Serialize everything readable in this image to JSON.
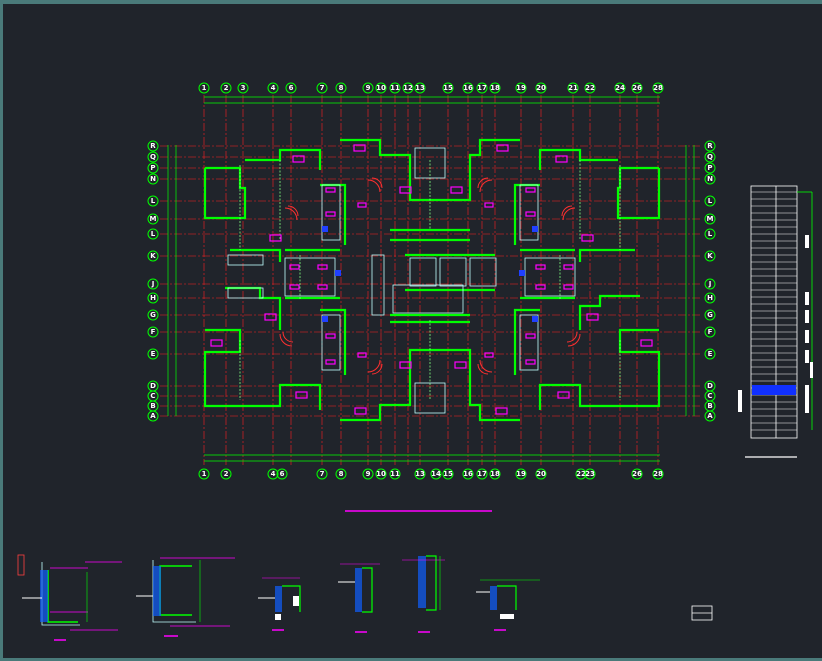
{
  "drawing": {
    "grid_axes_top": [
      "1",
      "2",
      "3",
      "4",
      "6",
      "7",
      "8",
      "9",
      "10",
      "11",
      "12",
      "13",
      "15",
      "16",
      "17",
      "18",
      "19",
      "20",
      "21",
      "22",
      "24",
      "26",
      "28"
    ],
    "grid_axes_bottom": [
      "1",
      "2",
      "4",
      "6",
      "7",
      "8",
      "9",
      "10",
      "11",
      "13",
      "14",
      "15",
      "16",
      "17",
      "18",
      "19",
      "20",
      "22",
      "23",
      "26",
      "28"
    ],
    "grid_axes_left": [
      "R",
      "Q",
      "P",
      "N",
      "L",
      "M",
      "L",
      "K",
      "J",
      "H",
      "G",
      "F",
      "E",
      "D",
      "C",
      "B",
      "A"
    ],
    "grid_axes_right": [
      "R",
      "Q",
      "P",
      "N",
      "L",
      "M",
      "L",
      "K",
      "J",
      "H",
      "G",
      "F",
      "E",
      "D",
      "C",
      "B",
      "A"
    ],
    "colors": {
      "background": "#20242b",
      "wall": "#00ff00",
      "grid_line": "#ff2020",
      "dimension": "#00ff00",
      "window": "#ff00ff",
      "door_swing": "#ff3030",
      "furniture": "#c0ffff",
      "column": "#2040ff",
      "frame": "#4a7a7a"
    }
  }
}
